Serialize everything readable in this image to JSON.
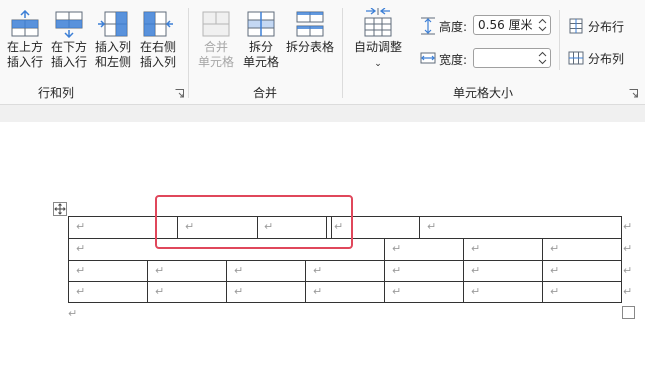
{
  "ribbon": {
    "groups": {
      "rows_cols": "行和列",
      "merge": "合并",
      "cell_size": "单元格大小"
    },
    "insert_above": [
      "在上方",
      "插入行"
    ],
    "insert_below": [
      "在下方",
      "插入行"
    ],
    "insert_left": [
      "插入列",
      "和左侧"
    ],
    "insert_right": [
      "在右侧",
      "插入列"
    ],
    "merge_cells": [
      "合并",
      "单元格"
    ],
    "split_cells": [
      "拆分",
      "单元格"
    ],
    "split_table": "拆分表格",
    "autofit": "自动调整",
    "height_label": "高度:",
    "height_value": "0.56 厘米",
    "width_label": "宽度:",
    "width_value": "",
    "distribute_rows": "分布行",
    "distribute_cols": "分布列"
  },
  "document": {
    "cell_mark": "↵",
    "colors": {
      "highlight": "#e0475b",
      "accent": "#3c7fd6",
      "grid": "#333333"
    }
  }
}
